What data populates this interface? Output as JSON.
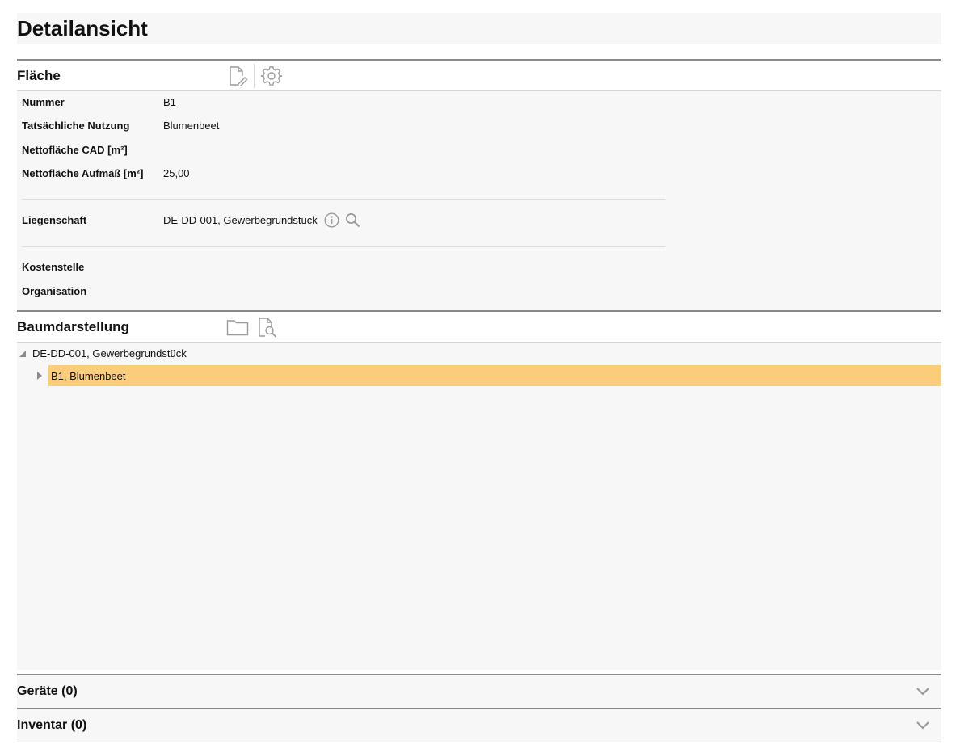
{
  "page": {
    "title": "Detailansicht"
  },
  "flaeche": {
    "header": "Fläche",
    "icons": [
      "edit-document-icon",
      "settings-gear-icon"
    ],
    "fields": {
      "nummer": {
        "label": "Nummer",
        "value": "B1"
      },
      "nutzung": {
        "label": "Tatsächliche Nutzung",
        "value": "Blumenbeet"
      },
      "cad": {
        "label": "Nettofläche CAD [m²]",
        "value": ""
      },
      "aufmass": {
        "label": "Nettofläche Aufmaß [m²]",
        "value": "25,00"
      },
      "liegenschaft": {
        "label": "Liegenschaft",
        "value": "DE-DD-001, Gewerbegrundstück"
      },
      "kostenstelle": {
        "label": "Kostenstelle",
        "value": ""
      },
      "organisation": {
        "label": "Organisation",
        "value": ""
      }
    }
  },
  "baum": {
    "header": "Baumdarstellung",
    "icons": [
      "folder-icon",
      "document-search-icon"
    ],
    "nodes": [
      {
        "label": "DE-DD-001, Gewerbegrundstück",
        "expanded": true,
        "level": 0
      },
      {
        "label": "B1, Blumenbeet",
        "expanded": false,
        "level": 1,
        "selected": true
      }
    ]
  },
  "geraete": {
    "header": "Geräte (0)"
  },
  "inventar": {
    "header": "Inventar (0)"
  },
  "colors": {
    "selection": "#fbcd7a",
    "panel": "#f7f7f7",
    "icon": "#9a9a9a",
    "rule": "#8a8a8a"
  }
}
